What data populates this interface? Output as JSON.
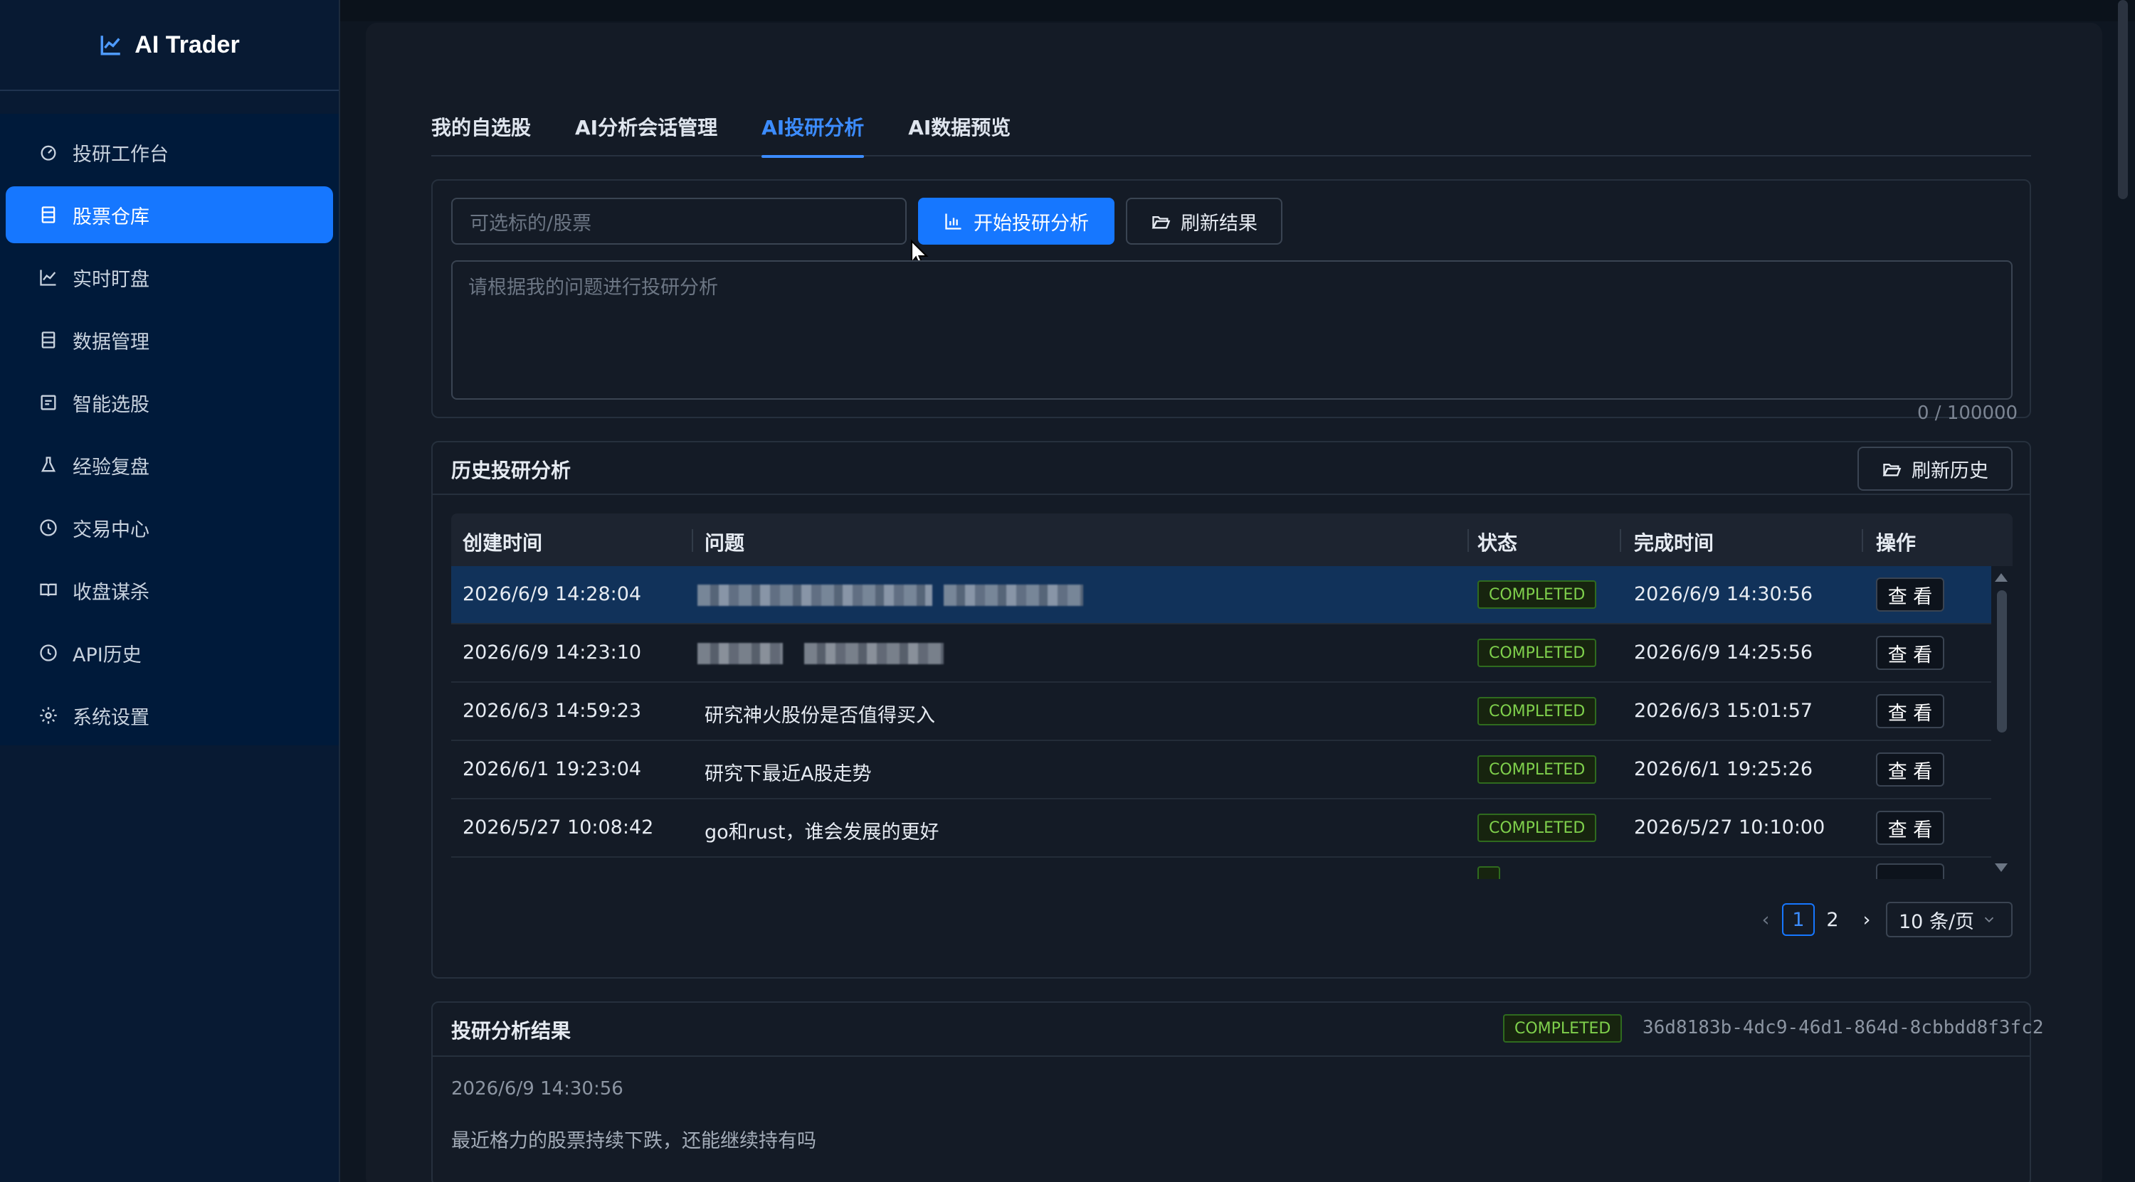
{
  "app": {
    "title": "AI Trader"
  },
  "sidebar": {
    "items": [
      {
        "label": "投研工作台",
        "icon": "dashboard-icon"
      },
      {
        "label": "股票仓库",
        "icon": "database-icon",
        "active": true
      },
      {
        "label": "实时盯盘",
        "icon": "line-chart-icon"
      },
      {
        "label": "数据管理",
        "icon": "database-icon"
      },
      {
        "label": "智能选股",
        "icon": "calendar-icon"
      },
      {
        "label": "经验复盘",
        "icon": "experiment-icon"
      },
      {
        "label": "交易中心",
        "icon": "clock-icon"
      },
      {
        "label": "收盘谋杀",
        "icon": "book-icon"
      },
      {
        "label": "API历史",
        "icon": "history-icon"
      },
      {
        "label": "系统设置",
        "icon": "gear-icon"
      }
    ]
  },
  "tabs": [
    {
      "label": "我的自选股"
    },
    {
      "label": "AI分析会话管理"
    },
    {
      "label": "AI投研分析",
      "active": true
    },
    {
      "label": "AI数据预览"
    }
  ],
  "analysis": {
    "symbol_placeholder": "可选标的/股票",
    "start_button": "开始投研分析",
    "refresh_result_button": "刷新结果",
    "question_placeholder": "请根据我的问题进行投研分析",
    "counter": "0 / 100000"
  },
  "history": {
    "title": "历史投研分析",
    "refresh_button": "刷新历史",
    "columns": {
      "created": "创建时间",
      "question": "问题",
      "status": "状态",
      "finished": "完成时间",
      "action": "操作"
    },
    "rows": [
      {
        "created": "2026/6/9 14:28:04",
        "question": "",
        "status": "COMPLETED",
        "finished": "2026/6/9 14:30:56",
        "action": "查 看",
        "selected": true
      },
      {
        "created": "2026/6/9 14:23:10",
        "question": "",
        "status": "COMPLETED",
        "finished": "2026/6/9 14:25:56",
        "action": "查 看"
      },
      {
        "created": "2026/6/3 14:59:23",
        "question": "研究神火股份是否值得买入",
        "status": "COMPLETED",
        "finished": "2026/6/3 15:01:57",
        "action": "查 看"
      },
      {
        "created": "2026/6/1 19:23:04",
        "question": "研究下最近A股走势",
        "status": "COMPLETED",
        "finished": "2026/6/1 19:25:26",
        "action": "查 看"
      },
      {
        "created": "2026/5/27 10:08:42",
        "question": "go和rust，谁会发展的更好",
        "status": "COMPLETED",
        "finished": "2026/5/27 10:10:00",
        "action": "查 看"
      }
    ],
    "pagination": {
      "pages": [
        "1",
        "2"
      ],
      "current": "1",
      "page_size": "10 条/页"
    }
  },
  "result": {
    "title": "投研分析结果",
    "status": "COMPLETED",
    "id": "36d8183b-4dc9-46d1-864d-8cbbdd8f3fc2",
    "time": "2026/6/9 14:30:56",
    "question": "最近格力的股票持续下跌，还能继续持有吗"
  },
  "colors": {
    "accent": "#1677ff",
    "sidebar_bg": "#001a3a",
    "success": "#7fd04c"
  }
}
